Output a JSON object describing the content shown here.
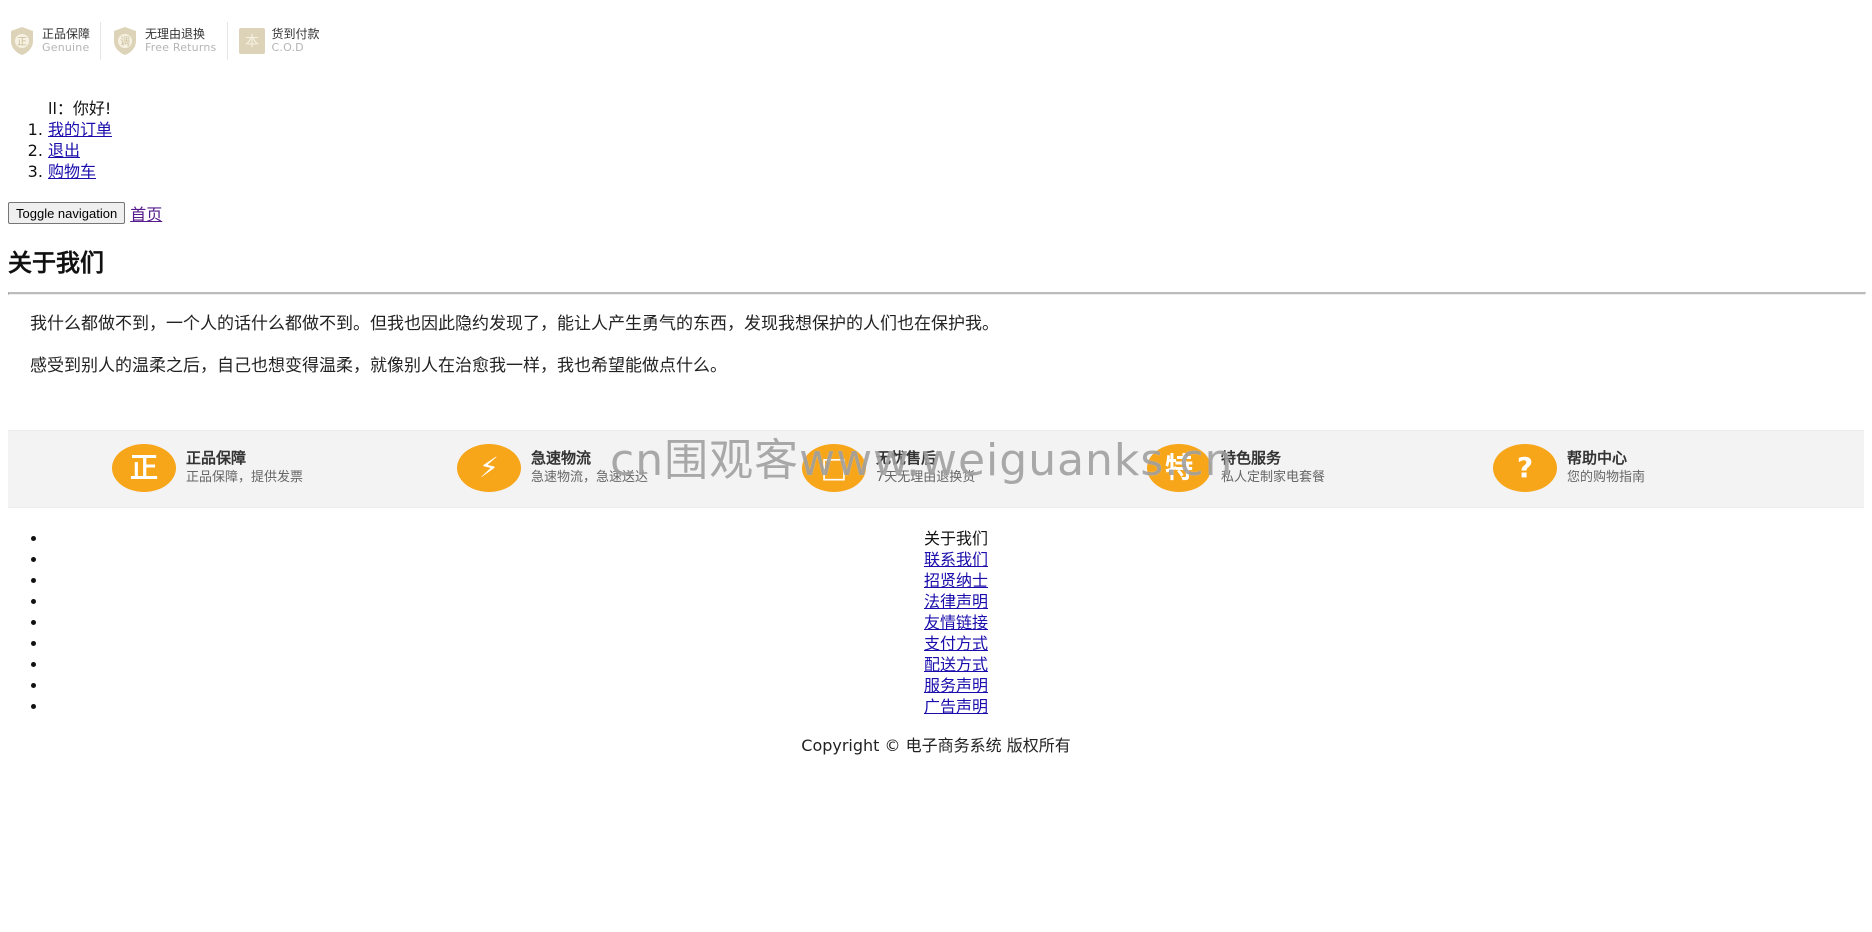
{
  "topbar": {
    "items": [
      {
        "title": "正品保障",
        "subtitle": "Genuine",
        "glyph": "正",
        "icon": "shield-icon"
      },
      {
        "title": "无理由退换",
        "subtitle": "Free Returns",
        "glyph": "调",
        "icon": "shield-icon"
      },
      {
        "title": "货到付款",
        "subtitle": "C.O.D",
        "glyph": "本",
        "icon": "cod-icon"
      }
    ]
  },
  "user": {
    "greeting": "ll：你好!",
    "links": [
      "我的订单",
      "退出",
      "购物车"
    ]
  },
  "nav": {
    "toggle_label": "Toggle navigation",
    "home_label": "首页"
  },
  "about": {
    "title": "关于我们",
    "paragraphs": [
      "我什么都做不到，一个人的话什么都做不到。但我也因此隐约发现了，能让人产生勇气的东西，发现我想保护的人们也在保护我。",
      "感受到别人的温柔之后，自己也想变得温柔，就像别人在治愈我一样，我也希望能做点什么。"
    ]
  },
  "services": [
    {
      "title": "正品保障",
      "subtitle": "正品保障，提供发票",
      "glyph": "正",
      "icon": "genuine-icon"
    },
    {
      "title": "急速物流",
      "subtitle": "急速物流，急速送达",
      "glyph": "⚡",
      "icon": "logistics-icon"
    },
    {
      "title": "无忧售后",
      "subtitle": "7天无理由退换货",
      "glyph": "□",
      "icon": "aftersale-icon"
    },
    {
      "title": "特色服务",
      "subtitle": "私人定制家电套餐",
      "glyph": "特",
      "icon": "special-service-icon"
    },
    {
      "title": "帮助中心",
      "subtitle": "您的购物指南",
      "glyph": "?",
      "icon": "help-icon"
    }
  ],
  "watermark": "cn围观客www.weiguanks.cn",
  "footer": {
    "links": [
      {
        "label": "关于我们",
        "is_link": false
      },
      {
        "label": "联系我们",
        "is_link": true
      },
      {
        "label": "招贤纳士",
        "is_link": true
      },
      {
        "label": "法律声明",
        "is_link": true
      },
      {
        "label": "友情链接",
        "is_link": true
      },
      {
        "label": "支付方式",
        "is_link": true
      },
      {
        "label": "配送方式",
        "is_link": true
      },
      {
        "label": "服务声明",
        "is_link": true
      },
      {
        "label": "广告声明",
        "is_link": true
      }
    ],
    "copyright": "Copyright © 电子商务系统 版权所有"
  },
  "colors": {
    "accent": "#f7a519",
    "link": "#1a0dab",
    "topbar_icon": "#ddd3b8",
    "strip_bg": "#f3f3f3"
  }
}
